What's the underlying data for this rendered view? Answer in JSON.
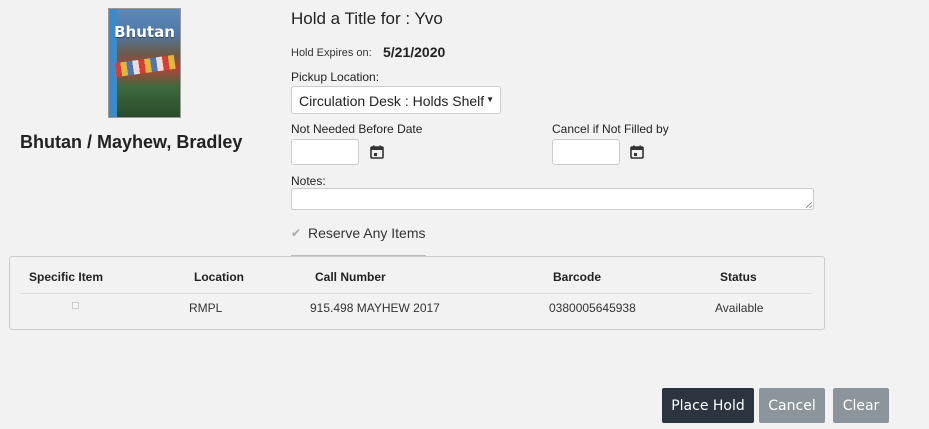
{
  "book": {
    "cover_text": "Bhutan",
    "title": "Bhutan / Mayhew, Bradley"
  },
  "hold": {
    "title": "Hold a Title for : Yvo",
    "expires_label": "Hold Expires on:",
    "expires_value": "5/21/2020",
    "pickup_label": "Pickup Location:",
    "pickup_value": "Circulation Desk : Holds Shelf",
    "not_needed_label": "Not Needed Before Date",
    "not_needed_value": "",
    "cancel_label": "Cancel if Not Filled by",
    "cancel_value": "",
    "notes_label": "Notes:",
    "notes_value": "",
    "reserve_label": "Reserve Any Items",
    "reserve_checked": true
  },
  "items_table": {
    "headers": [
      "Specific Item",
      "Location",
      "Call Number",
      "Barcode",
      "Status"
    ],
    "rows": [
      {
        "location": "RMPL",
        "call_number": "915.498 MAYHEW 2017",
        "barcode": "0380005645938",
        "status": "Available"
      }
    ]
  },
  "buttons": {
    "place_hold": "Place Hold",
    "cancel": "Cancel",
    "clear": "Clear"
  },
  "colors": {
    "primary_button": "#2c3440",
    "secondary_button": "#8c959b",
    "background": "#f2f2f2"
  },
  "icons": {
    "calendar": "calendar-icon",
    "dropdown": "chevron-down-icon",
    "checkbox": "checkmark-icon"
  }
}
